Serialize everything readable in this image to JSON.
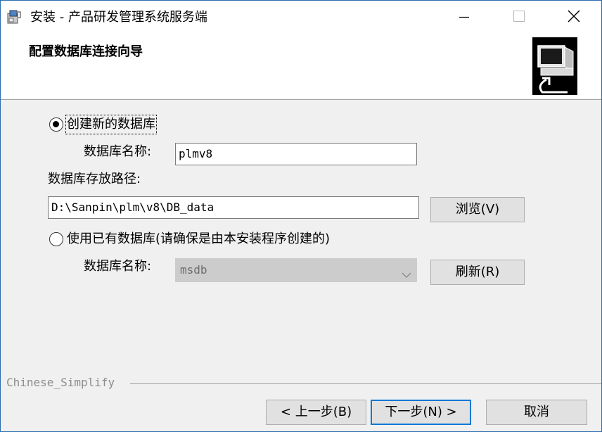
{
  "window": {
    "title": "安装 - 产品研发管理系统服务端",
    "icons": {
      "app": "installer-icon",
      "minimize": "minimize-icon",
      "maximize": "maximize-icon",
      "close": "close-icon"
    }
  },
  "header": {
    "title": "配置数据库连接向导",
    "image": "computer-setup-icon"
  },
  "create_new": {
    "label": "创建新的数据库",
    "selected": true,
    "db_name_label": "数据库名称:",
    "db_name_value": "plmv8",
    "path_label": "数据库存放路径:",
    "path_value": "D:\\Sanpin\\plm\\v8\\DB_data",
    "browse_button": "浏览(V)"
  },
  "use_existing": {
    "label": "使用已有数据库(请确保是由本安装程序创建的)",
    "selected": false,
    "db_name_label": "数据库名称:",
    "db_name_value": "msdb",
    "refresh_button": "刷新(R)"
  },
  "footer": {
    "brand": "Chinese_Simplify",
    "back_button": "< 上一步(B)",
    "next_button": "下一步(N) >",
    "cancel_button": "取消"
  },
  "colors": {
    "window_border": "#2b6cb0",
    "default_button_border": "#0078d7",
    "disabled_field": "#cccccc"
  }
}
